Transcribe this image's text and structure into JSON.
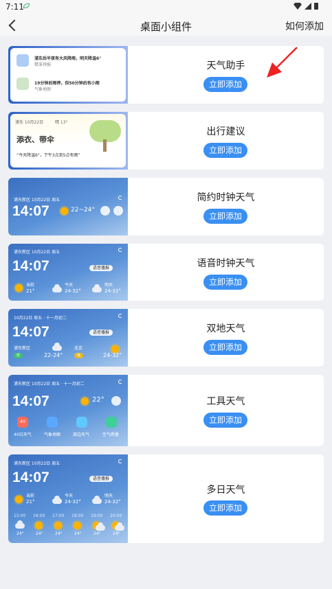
{
  "status_bar": {
    "time": "7:11"
  },
  "header": {
    "title": "桌面小组件",
    "help": "如何添加"
  },
  "add_label": "立即添加",
  "cards": [
    {
      "title": "天气助手",
      "preview": {
        "line1": "浦东后半夜有大风降雨，明天降温6°",
        "line1_sub": "精准预报",
        "line2": "19分钟后雨停，但50分钟后有小雨",
        "line2_sub": "气象地图"
      }
    },
    {
      "title": "出行建议",
      "preview": {
        "meta": "浦东  10月22日",
        "weather": "晴 13°",
        "headline": "添衣、带伞",
        "note": "“今天降温6°，下午3点到5点有雨”"
      }
    },
    {
      "title": "简约时钟天气",
      "preview": {
        "location": "浦东新区  10月22日  周五",
        "time": "14:07",
        "temp": "22~24°"
      }
    },
    {
      "title": "语音时钟天气",
      "preview": {
        "location": "浦东新区  10月22日  周五",
        "time": "14:07",
        "voice": "语音播报",
        "days": [
          {
            "label": "当前",
            "temp": "21°"
          },
          {
            "label": "今天",
            "temp": "24-32°"
          },
          {
            "label": "明天",
            "temp": "24-32°"
          }
        ]
      }
    },
    {
      "title": "双地天气",
      "preview": {
        "date": "10月22日  周五 · 十一月初二",
        "time": "14:07",
        "voice": "语音播报",
        "place1": "浦东新区",
        "temp1": "22-24°",
        "tag1": "优",
        "place2": "北京",
        "temp2": "24-32°",
        "tag2": "良"
      }
    },
    {
      "title": "工具天气",
      "preview": {
        "location": "浦东新区  10月22日  周五 · 十一月初二",
        "time": "14:07",
        "temp": "22°",
        "tools": [
          {
            "label": "40日天气",
            "badge": "40"
          },
          {
            "label": "气象地图"
          },
          {
            "label": "周边天气"
          },
          {
            "label": "空气质量"
          }
        ]
      }
    },
    {
      "title": "多日天气",
      "preview": {
        "location": "浦东新区  10月22日  周五",
        "time": "14:07",
        "voice": "语音播报",
        "days": [
          {
            "label": "当前",
            "temp": "21°"
          },
          {
            "label": "今天",
            "temp": "24-32°"
          },
          {
            "label": "明天",
            "temp": "24-32°"
          }
        ],
        "hours": [
          {
            "time": "15:00",
            "temp": "24°"
          },
          {
            "time": "16:00",
            "temp": "24°"
          },
          {
            "time": "17:00",
            "temp": "24°"
          },
          {
            "time": "18:00",
            "temp": "24°"
          },
          {
            "time": "19:00",
            "temp": "24°"
          },
          {
            "time": "20:00",
            "temp": "24°"
          }
        ]
      }
    }
  ],
  "colors": {
    "accent": "#3a8ff2",
    "highlight_arrow": "#ee2222"
  }
}
